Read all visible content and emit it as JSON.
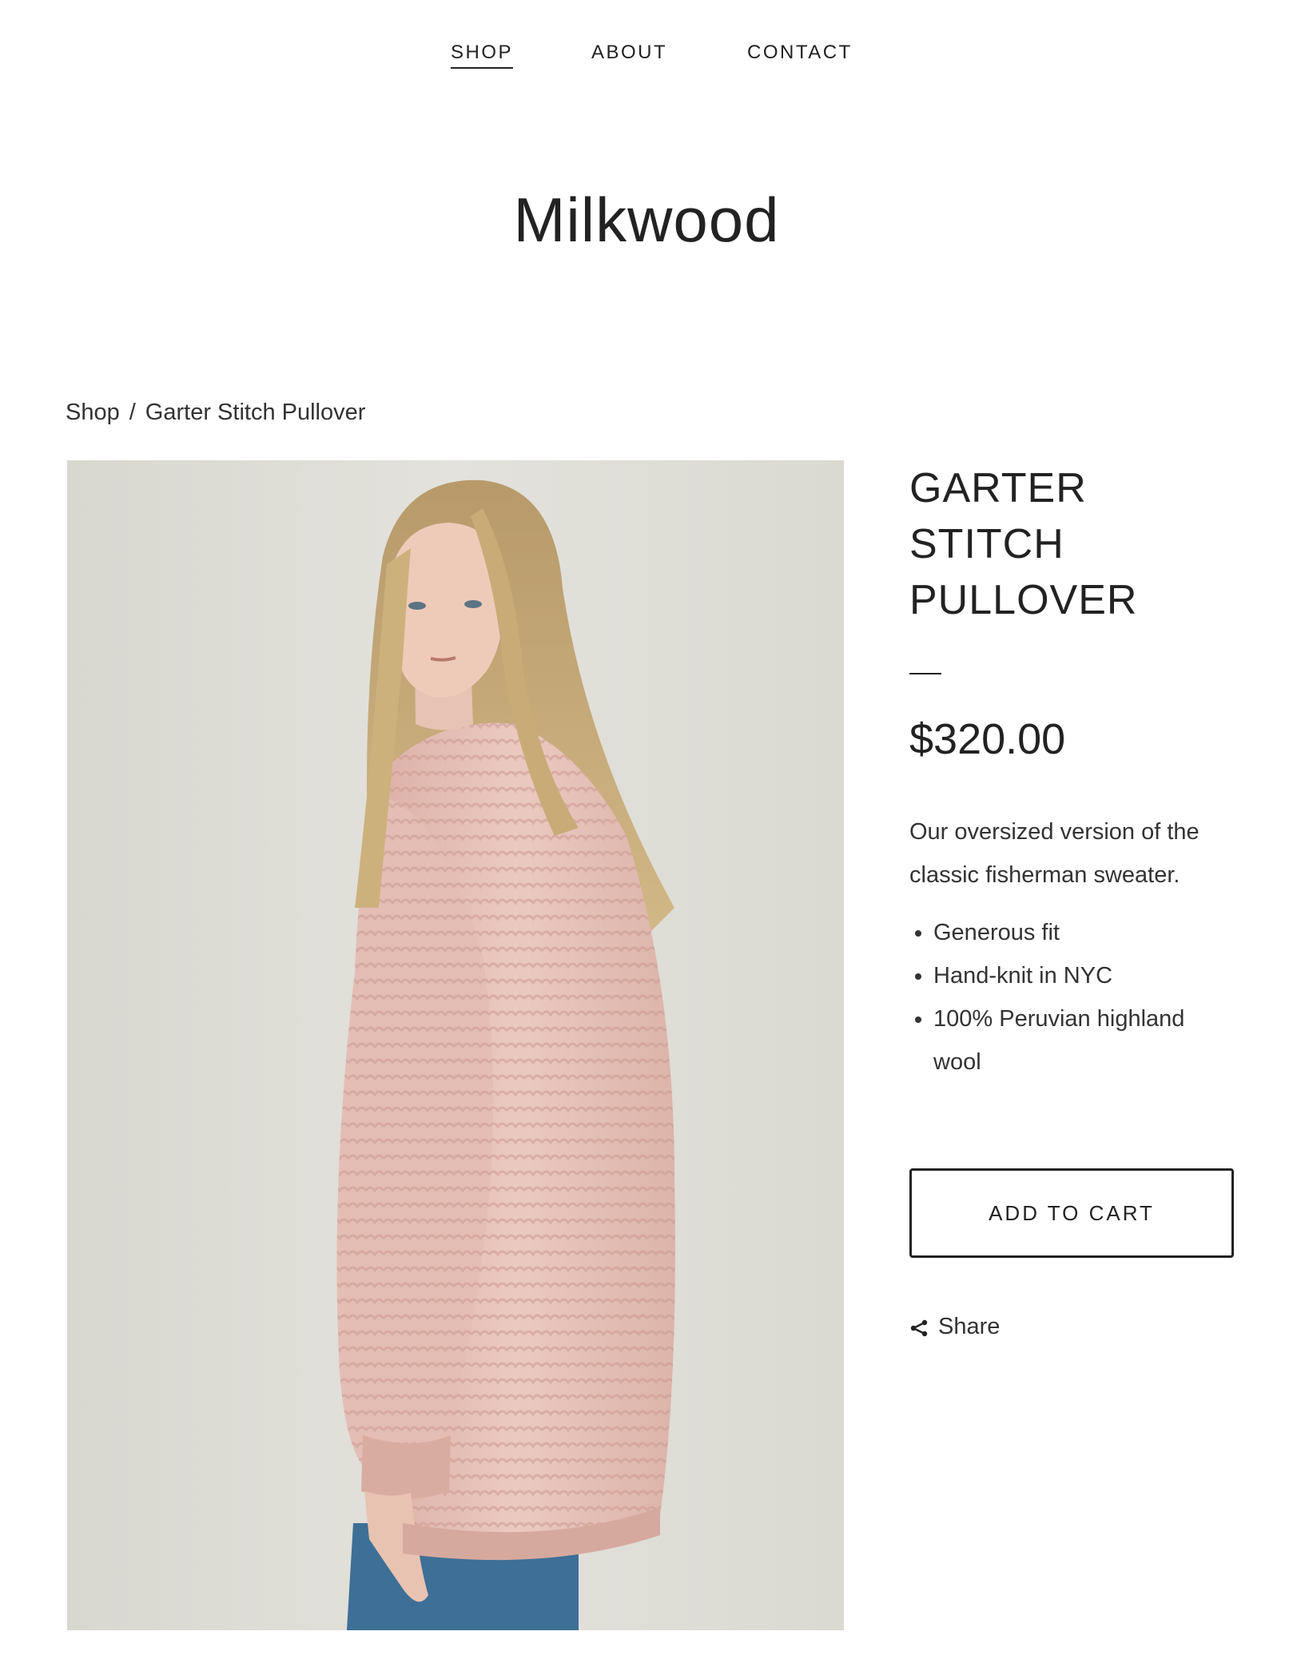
{
  "nav": {
    "items": [
      {
        "label": "SHOP",
        "active": true
      },
      {
        "label": "ABOUT",
        "active": false
      },
      {
        "label": "CONTACT",
        "active": false
      }
    ]
  },
  "site": {
    "title": "Milkwood"
  },
  "breadcrumb": {
    "parent": "Shop",
    "separator": "/",
    "current": "Garter Stitch Pullover"
  },
  "product": {
    "title_lines": [
      "GARTER",
      "STITCH",
      "PULLOVER"
    ],
    "price": "$320.00",
    "description": "Our oversized version of the classic fisherman sweater.",
    "features": [
      "Generous fit",
      "Hand-knit in NYC",
      "100% Peruvian highland wool"
    ],
    "add_to_cart_label": "ADD TO CART",
    "share_label": "Share",
    "share_icon": "share-icon",
    "image_subject": "product-photo"
  },
  "colors": {
    "text": "#222222",
    "background": "#ffffff",
    "photo_backdrop": "#dedcd5",
    "sweater_pink": "#e8c4bc",
    "hair_blonde": "#c9a872",
    "denim": "#3e6f96"
  }
}
